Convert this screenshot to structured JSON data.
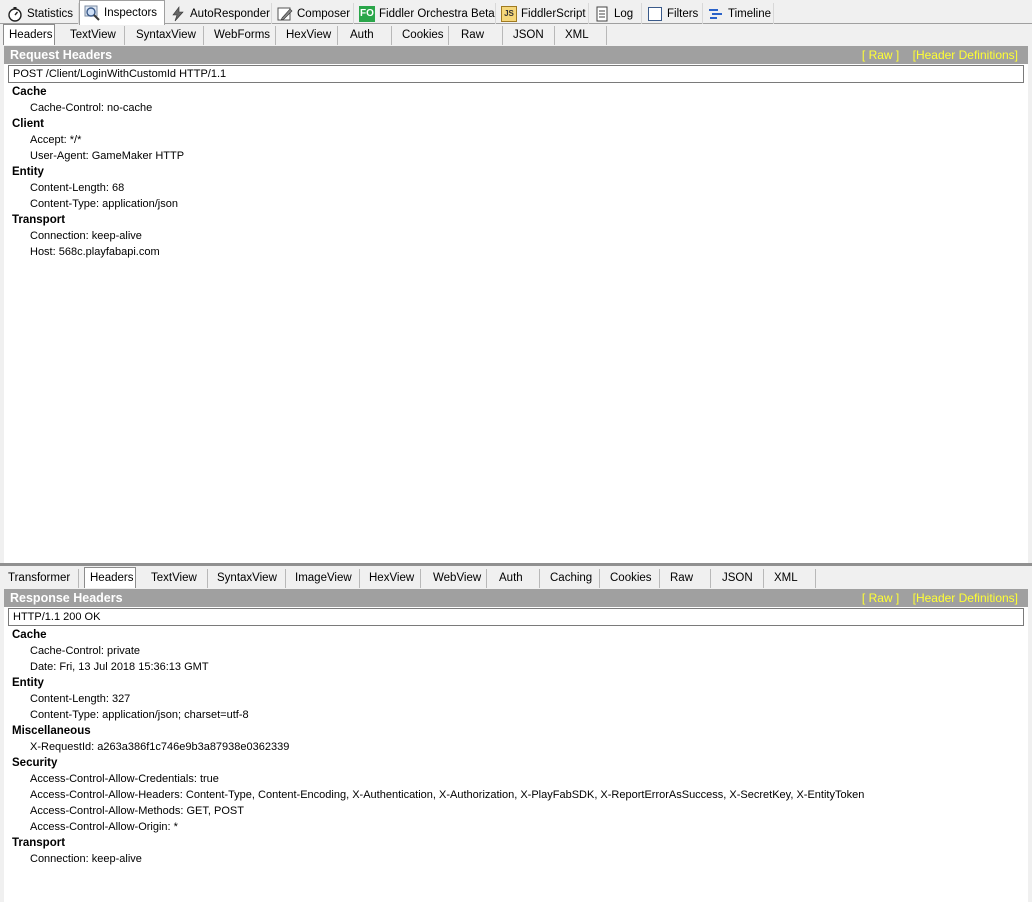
{
  "top_tabs": [
    {
      "label": "Statistics",
      "icon": "stopwatch-icon"
    },
    {
      "label": "Inspectors",
      "icon": "magnifier-icon"
    },
    {
      "label": "AutoResponder",
      "icon": "lightning-icon"
    },
    {
      "label": "Composer",
      "icon": "pencil-icon"
    },
    {
      "label": "Fiddler Orchestra Beta",
      "icon": "fo-icon",
      "icon_text": "FO"
    },
    {
      "label": "FiddlerScript",
      "icon": "script-icon",
      "icon_text": "JS"
    },
    {
      "label": "Log",
      "icon": "log-icon"
    },
    {
      "label": "Filters",
      "icon": "checkbox-icon"
    },
    {
      "label": "Timeline",
      "icon": "timeline-icon"
    }
  ],
  "request_tabs": [
    "Headers",
    "TextView",
    "SyntaxView",
    "WebForms",
    "HexView",
    "Auth",
    "Cookies",
    "Raw",
    "JSON",
    "XML"
  ],
  "request": {
    "title": "Request Headers",
    "link_raw": "[ Raw ]",
    "link_defs": "[Header Definitions]",
    "line": "POST /Client/LoginWithCustomId HTTP/1.1",
    "groups": [
      {
        "name": "Cache",
        "entries": [
          "Cache-Control: no-cache"
        ]
      },
      {
        "name": "Client",
        "entries": [
          "Accept: */*",
          "User-Agent: GameMaker HTTP"
        ]
      },
      {
        "name": "Entity",
        "entries": [
          "Content-Length: 68",
          "Content-Type: application/json"
        ]
      },
      {
        "name": "Transport",
        "entries": [
          "Connection: keep-alive",
          "Host: 568c.playfabapi.com"
        ]
      }
    ]
  },
  "response_tabs": [
    "Transformer",
    "Headers",
    "TextView",
    "SyntaxView",
    "ImageView",
    "HexView",
    "WebView",
    "Auth",
    "Caching",
    "Cookies",
    "Raw",
    "JSON",
    "XML"
  ],
  "response": {
    "title": "Response Headers",
    "link_raw": "[ Raw ]",
    "link_defs": "[Header Definitions]",
    "line": "HTTP/1.1 200 OK",
    "groups": [
      {
        "name": "Cache",
        "entries": [
          "Cache-Control: private",
          "Date: Fri, 13 Jul 2018 15:36:13 GMT"
        ]
      },
      {
        "name": "Entity",
        "entries": [
          "Content-Length: 327",
          "Content-Type: application/json; charset=utf-8"
        ]
      },
      {
        "name": "Miscellaneous",
        "entries": [
          "X-RequestId: a263a386f1c746e9b3a87938e0362339"
        ]
      },
      {
        "name": "Security",
        "entries": [
          "Access-Control-Allow-Credentials: true",
          "Access-Control-Allow-Headers: Content-Type, Content-Encoding, X-Authentication, X-Authorization, X-PlayFabSDK, X-ReportErrorAsSuccess, X-SecretKey, X-EntityToken",
          "Access-Control-Allow-Methods: GET, POST",
          "Access-Control-Allow-Origin: *"
        ]
      },
      {
        "name": "Transport",
        "entries": [
          "Connection: keep-alive"
        ]
      }
    ]
  },
  "colors": {
    "title_bar": "#a0a0a0",
    "link": "#ffff33"
  }
}
